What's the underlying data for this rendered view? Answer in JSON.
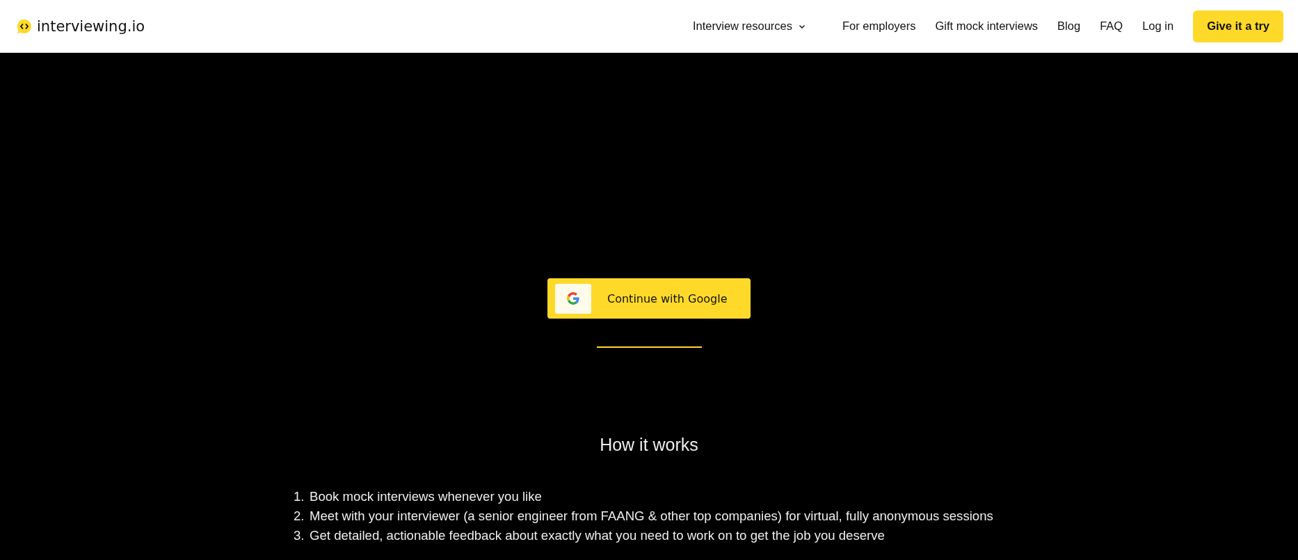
{
  "header": {
    "logo": "interviewing.io",
    "nav": [
      {
        "label": "Interview resources",
        "kind": "dropdown"
      },
      {
        "label": "For employers",
        "kind": "link"
      },
      {
        "label": "Gift mock interviews",
        "kind": "link"
      },
      {
        "label": "Blog",
        "kind": "link"
      },
      {
        "label": "FAQ",
        "kind": "link"
      },
      {
        "label": "Log in",
        "kind": "link"
      },
      {
        "label": "Give it a try",
        "kind": "cta"
      }
    ]
  },
  "signin": {
    "button": "Continue with Google"
  },
  "how_it_works": {
    "title": "How it works",
    "steps": [
      {
        "number": "1.",
        "text": "Book mock interviews whenever you like"
      },
      {
        "number": "2.",
        "text": "Meet with your interviewer (a senior engineer from FAANG & other top companies) for virtual, fully anonymous sessions"
      },
      {
        "number": "3.",
        "text": "Get detailed, actionable feedback about exactly what you need to work on to get the job you deserve"
      }
    ]
  }
}
